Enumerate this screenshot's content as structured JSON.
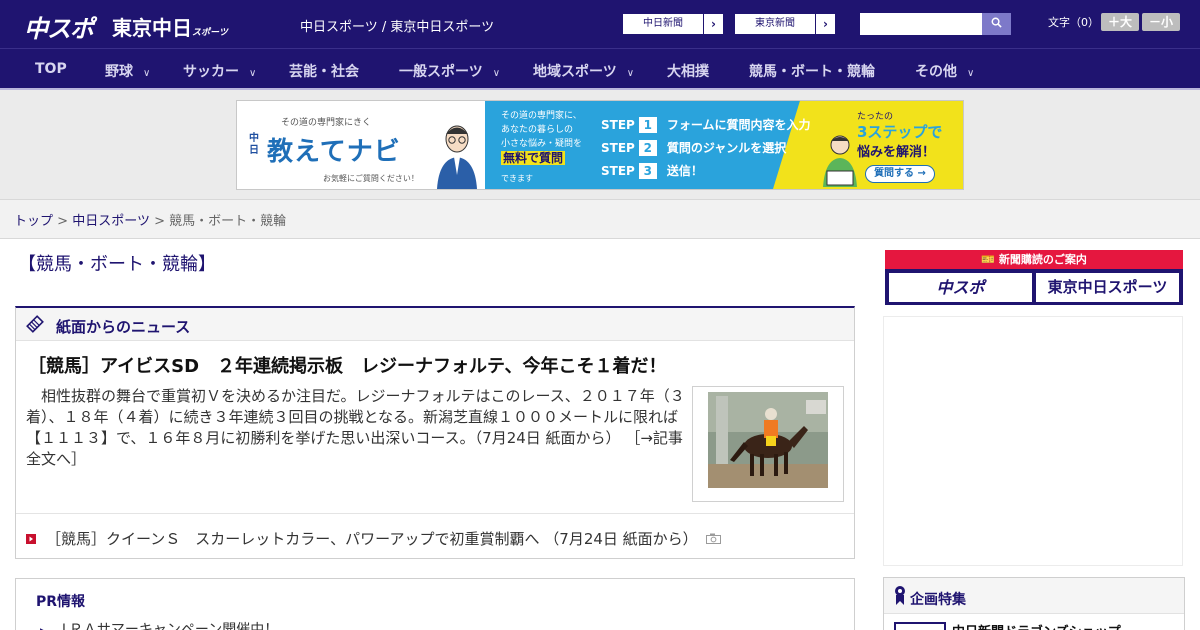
{
  "header": {
    "logo_main": "中スポ",
    "logo_tokyo": "東京中日",
    "logo_tokyo_sub": "スポーツ",
    "sites_text": "中日スポーツ / 東京中日スポーツ",
    "site_buttons": [
      "中日新聞",
      "東京新聞"
    ],
    "search_placeholder": "",
    "font_label": "文字（0）",
    "font_up": "＋大",
    "font_down": "－小"
  },
  "nav": {
    "items": [
      {
        "label": "TOP",
        "has_menu": false
      },
      {
        "label": "野球",
        "has_menu": true
      },
      {
        "label": "サッカー",
        "has_menu": true
      },
      {
        "label": "芸能・社会",
        "has_menu": false
      },
      {
        "label": "一般スポーツ",
        "has_menu": true
      },
      {
        "label": "地域スポーツ",
        "has_menu": true
      },
      {
        "label": "大相撲",
        "has_menu": false
      },
      {
        "label": "競馬・ボート・競輪",
        "has_menu": false
      },
      {
        "label": "その他",
        "has_menu": true
      }
    ]
  },
  "ad_banner": {
    "tagline": "その道の専門家にきく",
    "brand_small": "中日",
    "brand": "教えてナビ",
    "sub": "お気軽にご質問ください！",
    "mid_lines": [
      "その道の専門家に、",
      "あなたの暮らしの",
      "小さな悩み・疑問を"
    ],
    "mid_highlight": "無料で質問",
    "mid_foot": "できます",
    "steps": [
      {
        "label": "STEP",
        "num": "1",
        "text": "フォームに質問内容を入力"
      },
      {
        "label": "STEP",
        "num": "2",
        "text": "質問のジャンルを選択"
      },
      {
        "label": "STEP",
        "num": "3",
        "text": "送信！"
      }
    ],
    "right_top": "たったの",
    "right_hl": "3ステップで",
    "right_hl2": "悩みを解消！",
    "cta": "質問する →"
  },
  "breadcrumb": {
    "items": [
      "トップ",
      "中日スポーツ",
      "競馬・ボート・競輪"
    ],
    "sep": ">"
  },
  "page": {
    "title": "【競馬・ボート・競輪】"
  },
  "news": {
    "section_title": "紙面からのニュース",
    "headline": "［競馬］アイビスSD　２年連続掲示板　レジーナフォルテ、今年こそ１着だ！",
    "body": "相性抜群の舞台で重賞初Ｖを決めるか注目だ。レジーナフォルテはこのレース、２０１７年（３着）、１８年（４着）に続き３年連続３回目の挑戦となる。新潟芝直線１０００メートルに限れば【１１１３】で、１６年８月に初勝利を挙げた思い出深いコース。（7月24日 紙面から）",
    "more": "［→記事全文へ］",
    "item2": "［競馬］クイーンＳ　スカーレットカラー、パワーアップで初重賞制覇へ （7月24日 紙面から）"
  },
  "pr": {
    "title": "PR情報",
    "item": "ＪＲＡサマーキャンペーン開催中！"
  },
  "sidebar": {
    "subscribe_label": "新聞購読のご案内",
    "logo_1": "中スポ",
    "logo_2": "東京中日スポーツ",
    "feature_title": "企画特集",
    "feature_item": "中日新聞ドラゴンズショップ"
  },
  "colors": {
    "brand_navy": "#1f1470",
    "accent_red": "#e5173f",
    "ad_blue": "#2aa3dc",
    "ad_yellow": "#f2e21b"
  }
}
